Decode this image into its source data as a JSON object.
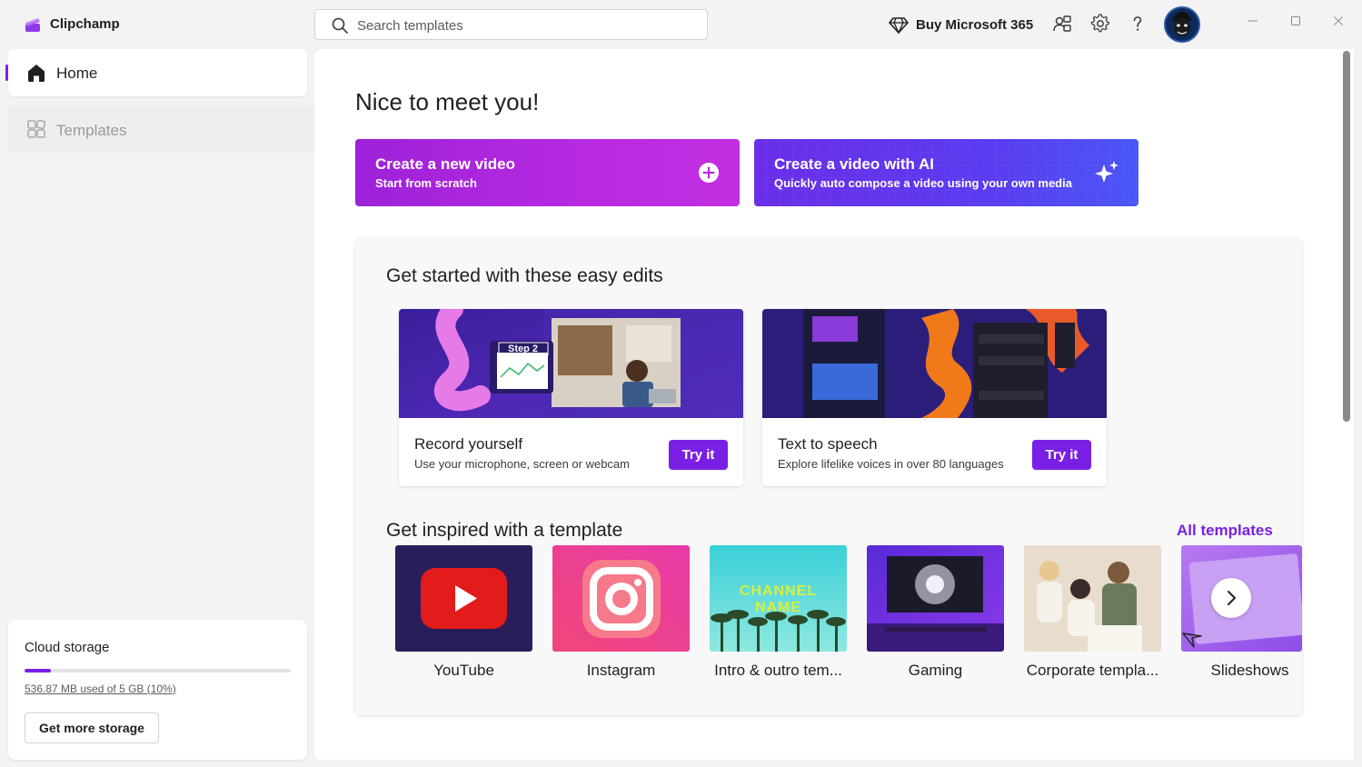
{
  "app": {
    "title": "Clipchamp"
  },
  "search": {
    "placeholder": "Search templates"
  },
  "header": {
    "buy_label": "Buy Microsoft 365"
  },
  "sidebar": {
    "items": [
      {
        "label": "Home",
        "active": true
      },
      {
        "label": "Templates",
        "active": false
      }
    ],
    "storage": {
      "title": "Cloud storage",
      "usage_text": "536.87 MB used of 5 GB (10%)",
      "percent_used": 10,
      "button_label": "Get more storage"
    }
  },
  "main": {
    "greeting": "Nice to meet you!",
    "cta_new": {
      "title": "Create a new video",
      "subtitle": "Start from scratch"
    },
    "cta_ai": {
      "title": "Create a video with AI",
      "subtitle": "Quickly auto compose a video using your own media"
    },
    "easy_edits": {
      "heading": "Get started with these easy edits",
      "cards": [
        {
          "title": "Record yourself",
          "subtitle": "Use your microphone, screen or webcam",
          "button": "Try it",
          "thumb_badge": "Step 2"
        },
        {
          "title": "Text to speech",
          "subtitle": "Explore lifelike voices in over 80 languages",
          "button": "Try it"
        }
      ]
    },
    "templates": {
      "heading": "Get inspired with a template",
      "all_link": "All templates",
      "items": [
        {
          "label": "YouTube"
        },
        {
          "label": "Instagram"
        },
        {
          "label": "Intro & outro tem...",
          "thumb_text": "CHANNEL NAME"
        },
        {
          "label": "Gaming"
        },
        {
          "label": "Corporate templa..."
        },
        {
          "label": "Slideshows"
        }
      ]
    }
  },
  "colors": {
    "accent": "#7a1fe5",
    "cta_new": "#b72ae0",
    "cta_ai": "#5b3bf0"
  }
}
